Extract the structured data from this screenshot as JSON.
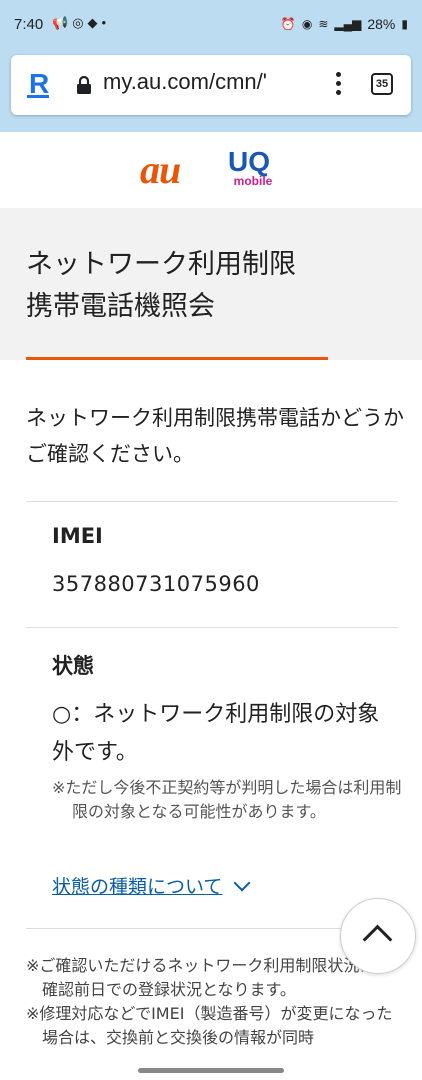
{
  "status_bar": {
    "time": "7:40",
    "left_icons": [
      "megaphone-icon",
      "chat-icon",
      "bug-icon",
      "dot"
    ],
    "battery": "28%"
  },
  "browser": {
    "url": "my.au.com/cmn/'",
    "tab_count": "35"
  },
  "brand": {
    "au": "au",
    "uq": "UQ",
    "uq_sub": "mobile",
    "accent": "#eb5505"
  },
  "page": {
    "title_line1": "ネットワーク利用制限",
    "title_line2": "携帯電話機照会",
    "intro": "ネットワーク利用制限携帯電話かどうかご確認ください。",
    "imei_label": "IMEI",
    "imei_value": "357880731075960",
    "status_label": "状態",
    "status_value": "○：ネットワーク利用制限の対象外です。",
    "status_note": "※ただし今後不正契約等が判明した場合は利用制限の対象となる可能性があります。",
    "status_link": "状態の種類について",
    "footnote1": "※ご確認いただけるネットワーク利用制限状況はご確認前日での登録状況となります。",
    "footnote2": "※修理対応などでIMEI（製造番号）が変更になった場合は、交換前と交換後の情報が同時"
  }
}
